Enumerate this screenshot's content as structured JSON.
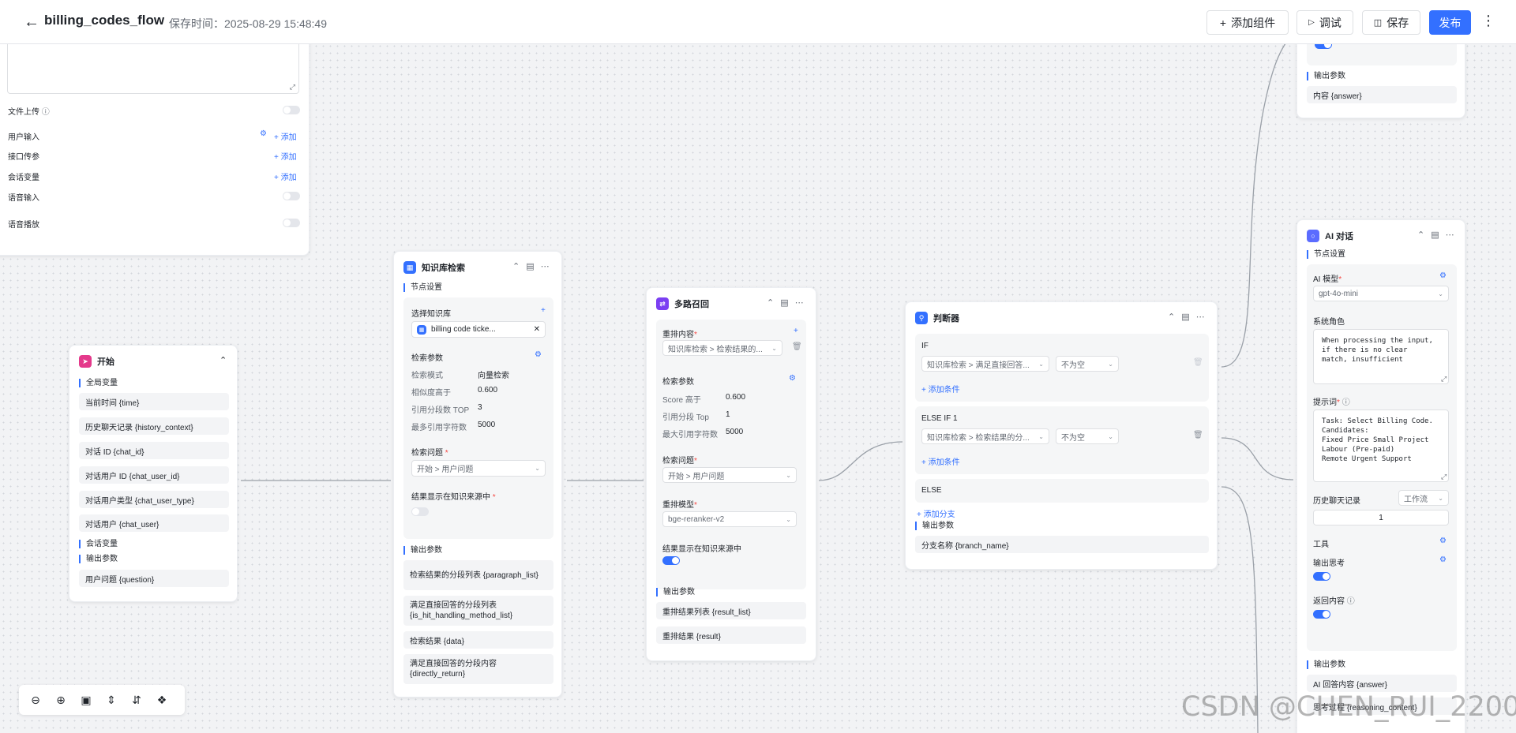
{
  "topbar": {
    "title": "billing_codes_flow",
    "save_time": "保存时间：2025-08-29 15:48:49",
    "add_component": "添加组件",
    "debug": "调试",
    "save": "保存",
    "publish": "发布"
  },
  "settings_panel": {
    "file_upload": "文件上传",
    "user_input": "用户输入",
    "api_params": "接口传参",
    "session_vars": "会话变量",
    "voice_input": "语音输入",
    "voice_playback": "语音播放",
    "add": "添加"
  },
  "start_node": {
    "title": "开始",
    "global_vars": "全局变量",
    "items": [
      "当前时间 {time}",
      "历史聊天记录 {history_context}",
      "对话 ID {chat_id}",
      "对话用户 ID {chat_user_id}",
      "对话用户类型 {chat_user_type}",
      "对话用户 {chat_user}"
    ],
    "session_vars": "会话变量",
    "output_params": "输出参数",
    "output_item": "用户问题 {question}"
  },
  "kb_node": {
    "title": "知识库检索",
    "node_settings": "节点设置",
    "select_kb": "选择知识库",
    "kb_name": "billing code ticke...",
    "search_params": "检索参数",
    "rows": [
      {
        "k": "检索模式",
        "v": "向量检索"
      },
      {
        "k": "相似度高于",
        "v": "0.600"
      },
      {
        "k": "引用分段数 TOP",
        "v": "3"
      },
      {
        "k": "最多引用字符数",
        "v": "5000"
      }
    ],
    "question": "检索问题",
    "question_value": "开始 > 用户问题",
    "show_source": "结果显示在知识来源中",
    "output_params": "输出参数",
    "outputs": [
      "检索结果的分段列表 {paragraph_list}",
      "满足直接回答的分段列表 {is_hit_handling_method_list}",
      "检索结果 {data}",
      "满足直接回答的分段内容 {directly_return}"
    ]
  },
  "rerank_node": {
    "title": "多路召回",
    "rerank_content": "重排内容",
    "content_value": "知识库检索 > 检索结果的...",
    "search_params": "检索参数",
    "rows": [
      {
        "k": "Score 高于",
        "v": "0.600"
      },
      {
        "k": "引用分段 Top",
        "v": "1"
      },
      {
        "k": "最大引用字符数",
        "v": "5000"
      }
    ],
    "question": "检索问题",
    "question_value": "开始 > 用户问题",
    "rerank_model": "重排模型",
    "model_value": "bge-reranker-v2",
    "show_source": "结果显示在知识来源中",
    "output_params": "输出参数",
    "outputs": [
      "重排结果列表 {result_list}",
      "重排结果 {result}"
    ]
  },
  "judge_node": {
    "title": "判断器",
    "if": "IF",
    "if_var": "知识库检索 > 满足直接回答...",
    "if_cond": "不为空",
    "add_condition": "添加条件",
    "elseif": "ELSE IF 1",
    "elseif_var": "知识库检索 > 检索结果的分...",
    "elseif_cond": "不为空",
    "else": "ELSE",
    "add_branch": "添加分支",
    "output_params": "输出参数",
    "output_item": "分支名称 {branch_name}"
  },
  "top_right_node": {
    "output_params": "输出参数",
    "output_item": "内容 {answer}"
  },
  "ai_node": {
    "title": "AI 对话",
    "node_settings": "节点设置",
    "ai_model": "AI 模型",
    "model_value": "gpt-4o-mini",
    "system_role": "系统角色",
    "system_text": "When processing the input,\nif there is no clear\nmatch, insufficient",
    "prompt": "提示词",
    "prompt_text": "Task: Select Billing Code.\nCandidates:\nFixed Price Small Project\nLabour (Pre-paid)\nRemote Urgent Support",
    "history": "历史聊天记录",
    "history_mode": "工作流",
    "history_count": "1",
    "tools": "工具",
    "output_thinking": "输出思考",
    "return_content": "返回内容",
    "output_params": "输出参数",
    "outputs": [
      "AI 回答内容 {answer}",
      "思考过程 {reasoning_content}"
    ]
  },
  "watermark": "CSDN @CHEN_RUI_2200",
  "colors": {
    "accent": "#3370ff",
    "start_icon": "#e4398b",
    "kb_icon": "#3370ff",
    "rerank_icon": "#7b3ff2",
    "judge_icon": "#3370ff",
    "ai_icon": "#5b6cff"
  }
}
